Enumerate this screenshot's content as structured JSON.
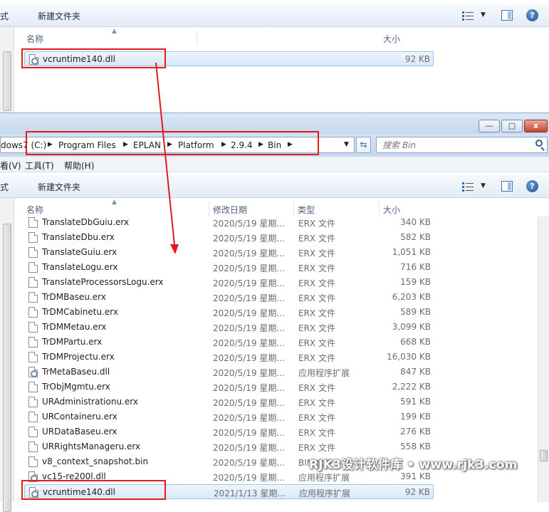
{
  "top_window": {
    "toolbar": {
      "left_partial": "式",
      "new_folder": "新建文件夹"
    },
    "columns": {
      "name": "名称",
      "size": "大小"
    },
    "file": {
      "name": "vcruntime140.dll",
      "size": "92 KB"
    }
  },
  "main_window": {
    "title_buttons": {
      "minimize": "—",
      "maximize": "□",
      "close": "x"
    },
    "address": {
      "crumbs": [
        "dows7 (C:)",
        "Program Files",
        "EPLAN",
        "Platform",
        "2.9.4",
        "Bin"
      ]
    },
    "search": {
      "placeholder": "搜索 Bin"
    },
    "menu": {
      "view": "看(V)",
      "tools": "工具(T)",
      "help": "帮助(H)"
    },
    "toolbar": {
      "left_partial": "式",
      "new_folder": "新建文件夹"
    },
    "columns": {
      "name": "名称",
      "date": "修改日期",
      "type": "类型",
      "size": "大小"
    },
    "files": [
      {
        "name": "TranslateDbGuiu.erx",
        "date": "2020/5/19 星期...",
        "type": "ERX 文件",
        "size": "340 KB",
        "icon": "file"
      },
      {
        "name": "TranslateDbu.erx",
        "date": "2020/5/19 星期...",
        "type": "ERX 文件",
        "size": "582 KB",
        "icon": "file"
      },
      {
        "name": "TranslateGuiu.erx",
        "date": "2020/5/19 星期...",
        "type": "ERX 文件",
        "size": "1,051 KB",
        "icon": "file"
      },
      {
        "name": "TranslateLogu.erx",
        "date": "2020/5/19 星期...",
        "type": "ERX 文件",
        "size": "716 KB",
        "icon": "file"
      },
      {
        "name": "TranslateProcessorsLogu.erx",
        "date": "2020/5/19 星期...",
        "type": "ERX 文件",
        "size": "159 KB",
        "icon": "file"
      },
      {
        "name": "TrDMBaseu.erx",
        "date": "2020/5/19 星期...",
        "type": "ERX 文件",
        "size": "6,203 KB",
        "icon": "file"
      },
      {
        "name": "TrDMCabinetu.erx",
        "date": "2020/5/19 星期...",
        "type": "ERX 文件",
        "size": "589 KB",
        "icon": "file"
      },
      {
        "name": "TrDMMetau.erx",
        "date": "2020/5/19 星期...",
        "type": "ERX 文件",
        "size": "3,099 KB",
        "icon": "file"
      },
      {
        "name": "TrDMPartu.erx",
        "date": "2020/5/19 星期...",
        "type": "ERX 文件",
        "size": "668 KB",
        "icon": "file"
      },
      {
        "name": "TrDMProjectu.erx",
        "date": "2020/5/19 星期...",
        "type": "ERX 文件",
        "size": "16,030 KB",
        "icon": "file"
      },
      {
        "name": "TrMetaBaseu.dll",
        "date": "2020/5/19 星期...",
        "type": "应用程序扩展",
        "size": "847 KB",
        "icon": "dll"
      },
      {
        "name": "TrObjMgmtu.erx",
        "date": "2020/5/19 星期...",
        "type": "ERX 文件",
        "size": "2,222 KB",
        "icon": "file"
      },
      {
        "name": "URAdministrationu.erx",
        "date": "2020/5/19 星期...",
        "type": "ERX 文件",
        "size": "591 KB",
        "icon": "file"
      },
      {
        "name": "URContaineru.erx",
        "date": "2020/5/19 星期...",
        "type": "ERX 文件",
        "size": "199 KB",
        "icon": "file"
      },
      {
        "name": "URDataBaseu.erx",
        "date": "2020/5/19 星期...",
        "type": "ERX 文件",
        "size": "276 KB",
        "icon": "file"
      },
      {
        "name": "URRightsManageru.erx",
        "date": "2020/5/19 星期...",
        "type": "ERX 文件",
        "size": "558 KB",
        "icon": "file"
      },
      {
        "name": "v8_context_snapshot.bin",
        "date": "2020/5/19 星期...",
        "type": "BIN 文件",
        "size": "",
        "icon": "file"
      },
      {
        "name": "vc15-re200l.dll",
        "date": "2020/5/19 星期...",
        "type": "应用程序扩展",
        "size": "391 KB",
        "icon": "dll"
      },
      {
        "name": "vcruntime140.dll",
        "date": "2021/1/13 星期...",
        "type": "应用程序扩展",
        "size": "92 KB",
        "icon": "dll",
        "selected": true
      }
    ]
  },
  "watermark": "RJK3设计软件库 • www.rjk3.com",
  "colors": {
    "highlight_box": "#e21b1b",
    "selection": "#d9e8f9"
  }
}
